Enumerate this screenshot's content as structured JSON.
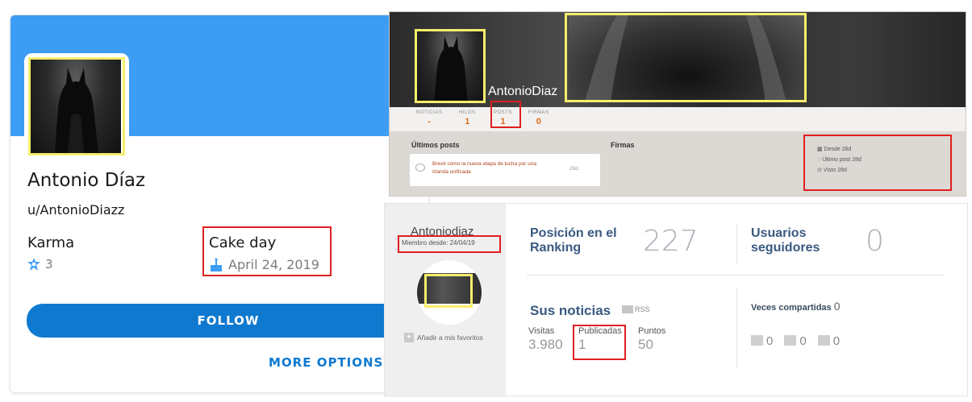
{
  "reddit": {
    "display_name": "Antonio Díaz",
    "username": "u/AntonioDiazz",
    "karma_label": "Karma",
    "karma_value": "3",
    "cake_label": "Cake day",
    "cake_value": "April 24, 2019",
    "follow_label": "FOLLOW",
    "more_label": "MORE OPTIONS",
    "banner_color": "#3d9df4",
    "accent_color": "#0f79d0"
  },
  "forum": {
    "name": "AntonioDiaz",
    "stats": [
      {
        "label": "NOTICIAS",
        "value": "-"
      },
      {
        "label": "HILOS",
        "value": "1"
      },
      {
        "label": "POSTS",
        "value": "1"
      },
      {
        "label": "FIRMAS",
        "value": "0"
      }
    ],
    "latest_posts_title": "Últimos posts",
    "signatures_title": "Firmas",
    "post_text": "Brexit como la nueva etapa de lucha por una Irlanda unificada",
    "post_age": "28d",
    "meta": [
      "Desde 28d",
      "Último post 28d",
      "Visto 28d"
    ]
  },
  "meneame": {
    "name": "Antoniodiaz",
    "member_since": "Miembro desde: 24/04/19",
    "fav_label": "Añadir a mis favoritos",
    "ranking_label": "Posición en el Ranking",
    "ranking_value": "227",
    "followers_label": "Usuarios seguidores",
    "followers_value": "0",
    "news_label": "Sus noticias",
    "rss_label": "RSS",
    "visits_label": "Visitas",
    "visits_value": "3.980",
    "published_label": "Publicadas",
    "published_value": "1",
    "points_label": "Puntos",
    "points_value": "50",
    "shared_label": "Veces compartidas",
    "shared_value": "0",
    "share_counts": [
      "0",
      "0",
      "0"
    ]
  },
  "highlight_colors": {
    "red": "#e02020",
    "yellow": "#f5ee6b"
  }
}
